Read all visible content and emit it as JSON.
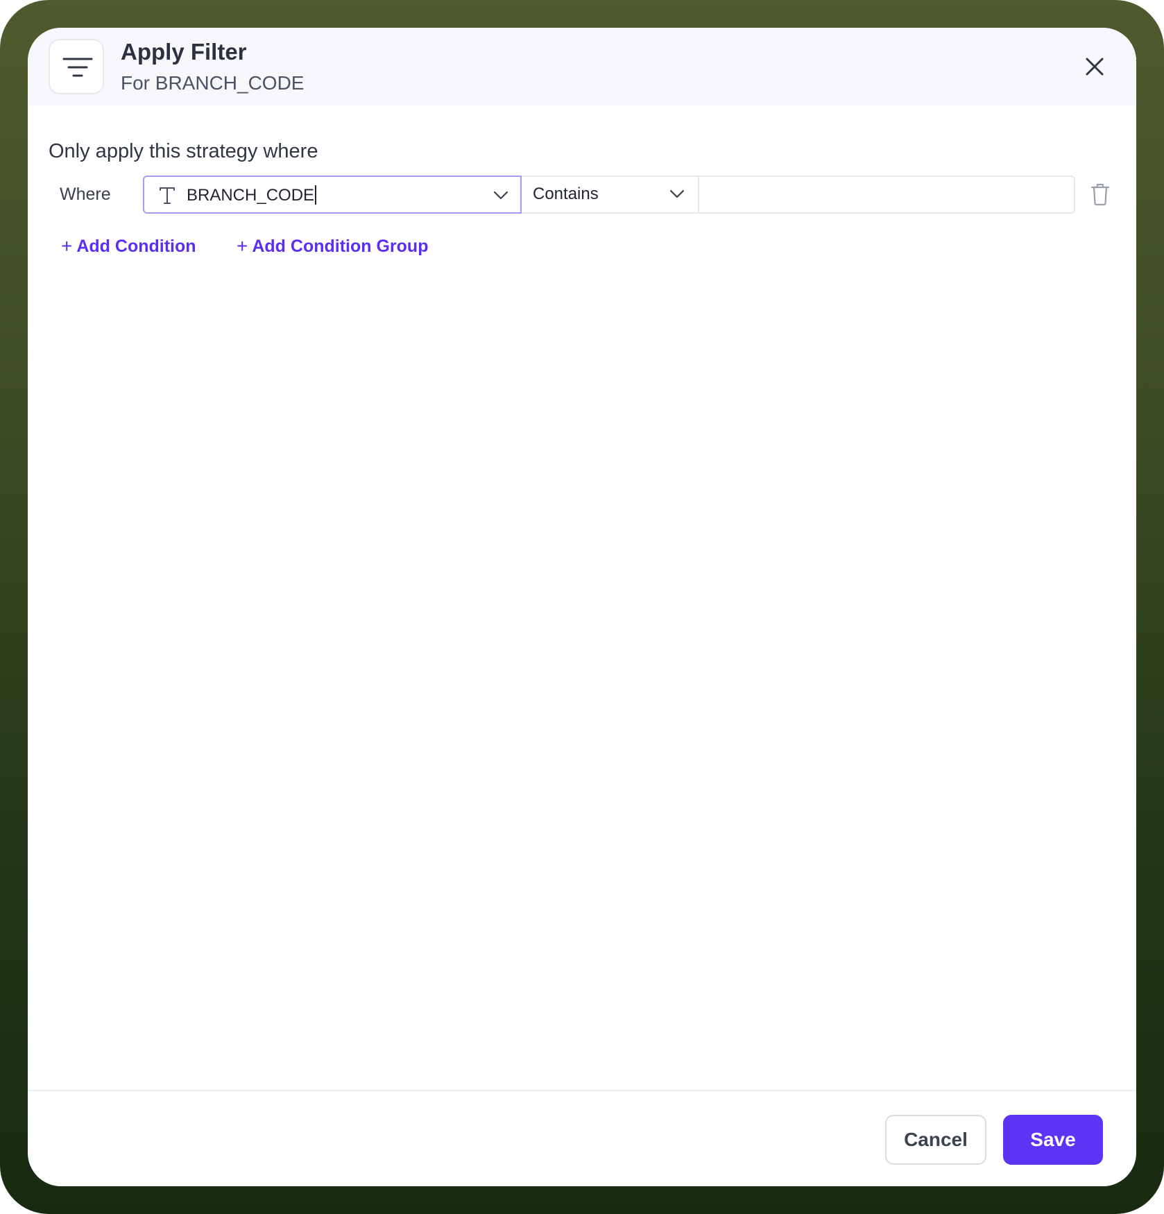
{
  "dialog": {
    "title": "Apply Filter",
    "subtitle": "For BRANCH_CODE",
    "header_icon": "filter-lines-icon",
    "close_icon": "close-icon"
  },
  "condition": {
    "section_label": "Only apply this strategy where",
    "where_label": "Where",
    "field": {
      "type_icon": "text-type-icon",
      "value": "BRANCH_CODE"
    },
    "operator": {
      "value": "Contains"
    },
    "value_input": {
      "value": "",
      "placeholder": ""
    },
    "delete_icon": "trash-icon"
  },
  "actions": {
    "add_condition": "Add Condition",
    "add_condition_group": "Add Condition Group",
    "plus_icon": "+",
    "cancel": "Cancel",
    "save": "Save"
  },
  "colors": {
    "accent": "#5b34f5",
    "link": "#5a2ff0",
    "focus_border": "#a79af0",
    "frame_top": "#4f5b2e",
    "frame_bottom": "#182b10"
  }
}
